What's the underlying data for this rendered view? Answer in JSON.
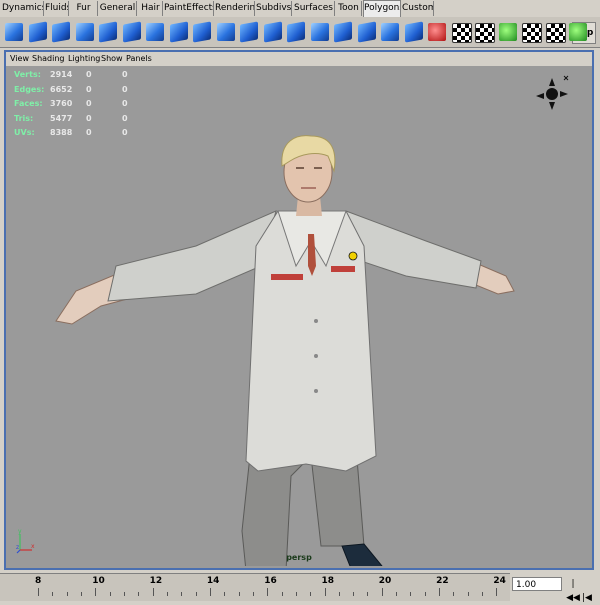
{
  "shelf_tabs": [
    {
      "label": "Dynamics",
      "active": false
    },
    {
      "label": "Fluids",
      "active": false
    },
    {
      "label": "Fur",
      "active": false
    },
    {
      "label": "General",
      "active": false
    },
    {
      "label": "Hair",
      "active": false
    },
    {
      "label": "PaintEffects",
      "active": false
    },
    {
      "label": "Rendering",
      "active": false
    },
    {
      "label": "Subdivs",
      "active": false
    },
    {
      "label": "Surfaces",
      "active": false
    },
    {
      "label": "Toon",
      "active": false
    },
    {
      "label": "Polygons",
      "active": true
    },
    {
      "label": "Custom",
      "active": false
    }
  ],
  "shelf_flip_label": "Flip",
  "panel_menu": [
    "View",
    "Shading",
    "Lighting",
    "Show",
    "Panels"
  ],
  "hud": [
    {
      "label": "Verts:",
      "v1": "2914",
      "v2": "0",
      "v3": "0"
    },
    {
      "label": "Edges:",
      "v1": "6652",
      "v2": "0",
      "v3": "0"
    },
    {
      "label": "Faces:",
      "v1": "3760",
      "v2": "0",
      "v3": "0"
    },
    {
      "label": "Tris:",
      "v1": "5477",
      "v2": "0",
      "v3": "0"
    },
    {
      "label": "UVs:",
      "v1": "8388",
      "v2": "0",
      "v3": "0"
    }
  ],
  "camera_label": "persp",
  "axis_labels": {
    "x": "x",
    "y": "y",
    "z": "z"
  },
  "timeline_ticks": [
    "8",
    "10",
    "12",
    "14",
    "16",
    "18",
    "20",
    "22",
    "24"
  ],
  "current_time": "1.00",
  "time_controls": [
    "|◀◀",
    "|◀"
  ],
  "colors": {
    "frame_border": "#4a6fb0",
    "viewport_bg": "#9a9a9a",
    "hud_label": "#7ff0a8"
  }
}
